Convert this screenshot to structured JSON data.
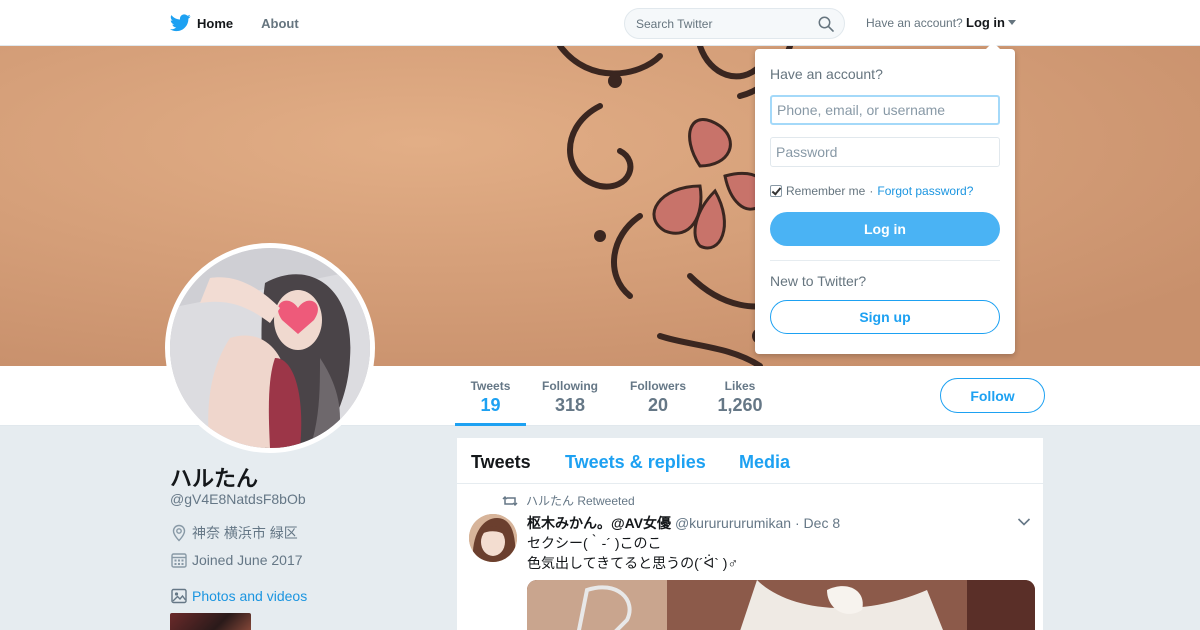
{
  "nav": {
    "home_label": "Home",
    "about_label": "About",
    "search_placeholder": "Search Twitter",
    "account_prompt": "Have an account?",
    "login_label": "Log in"
  },
  "login_dropdown": {
    "title": "Have an account?",
    "username_placeholder": "Phone, email, or username",
    "password_placeholder": "Password",
    "remember_label": "Remember me",
    "separator": "·",
    "forgot_label": "Forgot password?",
    "login_button": "Log in",
    "new_prompt": "New to Twitter?",
    "signup_button": "Sign up"
  },
  "profile": {
    "name": "ハルたん",
    "handle": "@gV4E8NatdsF8bOb",
    "location": "神奈 横浜市 緑区",
    "joined": "Joined June 2017",
    "photos_link": "Photos and videos"
  },
  "stats": [
    {
      "label": "Tweets",
      "value": "19",
      "active": true
    },
    {
      "label": "Following",
      "value": "318",
      "active": false
    },
    {
      "label": "Followers",
      "value": "20",
      "active": false
    },
    {
      "label": "Likes",
      "value": "1,260",
      "active": false
    }
  ],
  "follow_button": "Follow",
  "timeline": {
    "tabs": [
      "Tweets",
      "Tweets & replies",
      "Media"
    ],
    "tweet": {
      "retweeted_by": "ハルたん Retweeted",
      "fullname": "枢木みかん。@AV女優",
      "username": "@kururururumikan",
      "separator": "·",
      "time": "Dec 8",
      "line1": "セクシー(｀-´ )このこ",
      "line2": "色気出してきてると思うの(´ᐛ` )♂"
    }
  },
  "colors": {
    "accent": "#1da1f2",
    "link": "#1b95e0",
    "login_button": "#4ab3f4",
    "background": "#e6ecf0"
  },
  "icons": {
    "logo": "twitter-bird-icon",
    "search": "search-icon",
    "location": "location-pin-icon",
    "calendar": "calendar-icon",
    "photos": "photo-icon",
    "retweet": "retweet-icon",
    "caret": "chevron-down-icon"
  }
}
